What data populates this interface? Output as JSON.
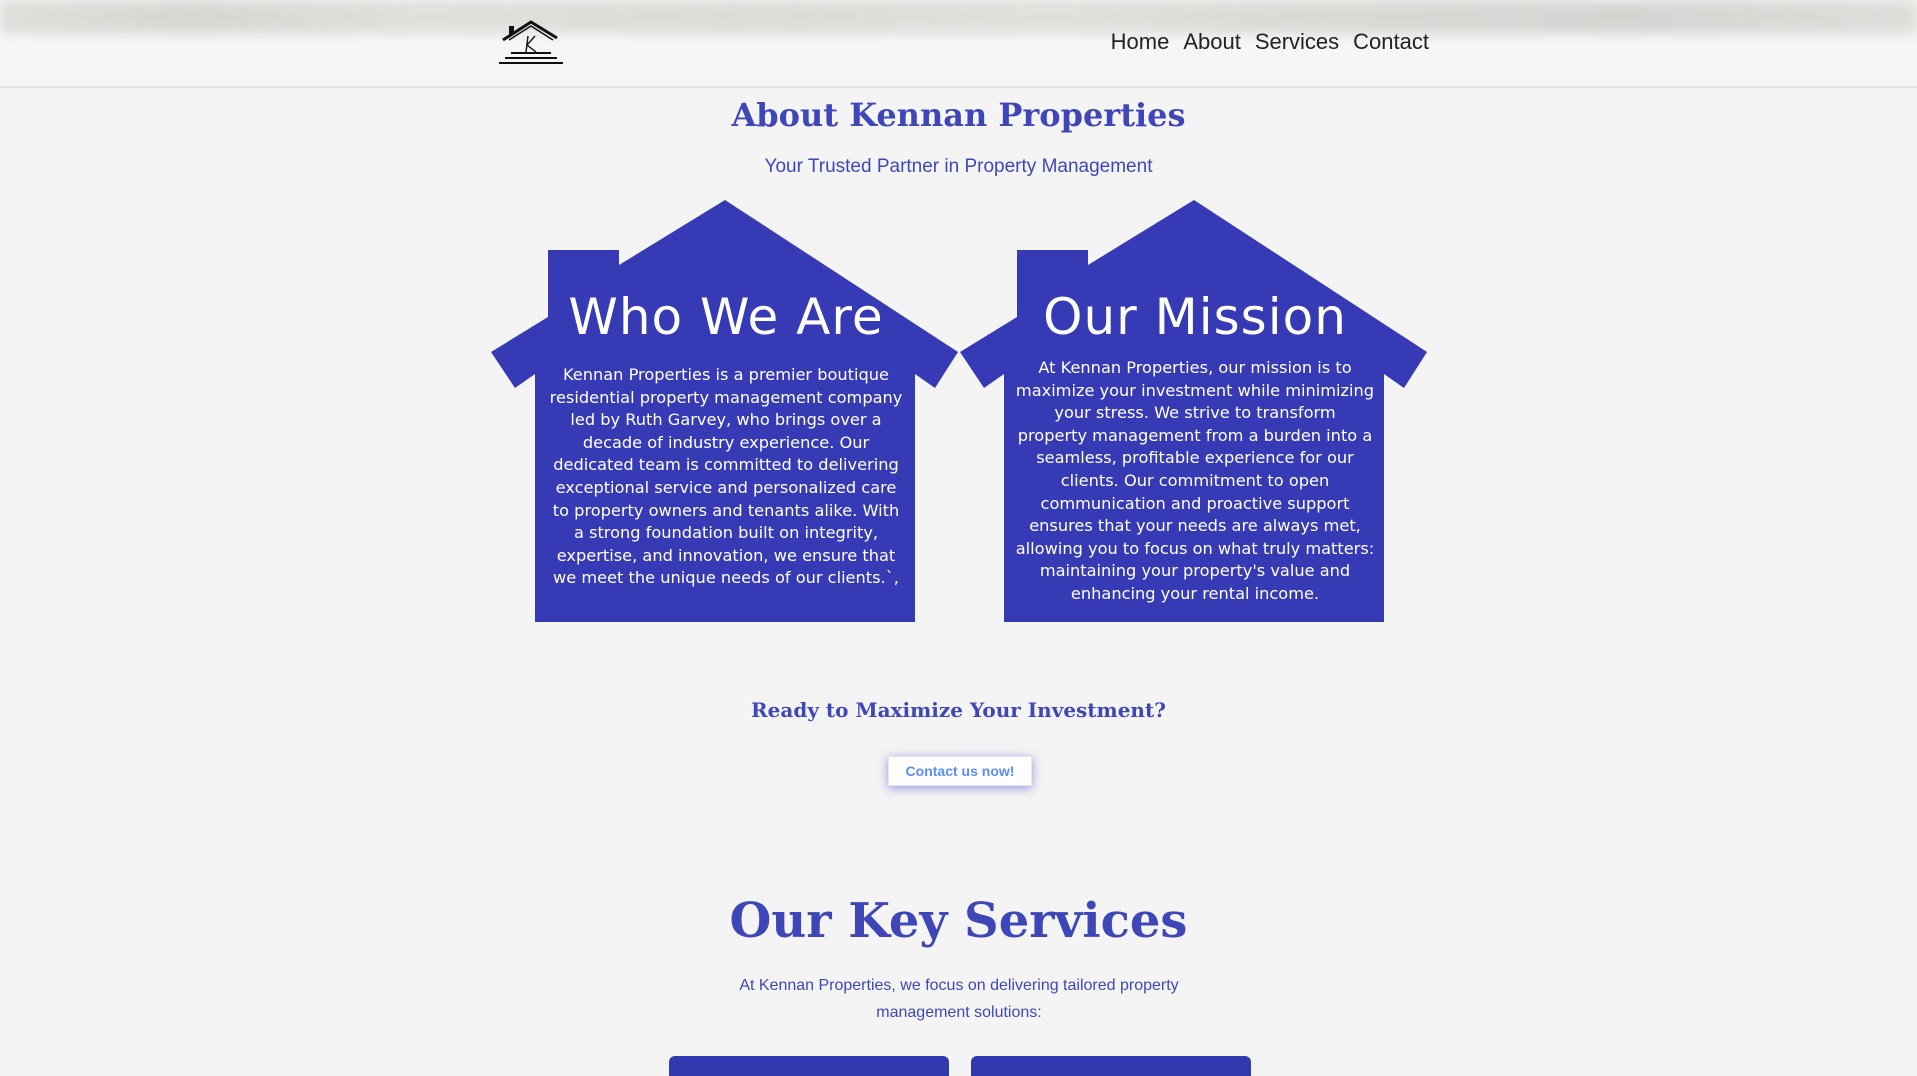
{
  "header": {
    "nav": [
      "Home",
      "About",
      "Services",
      "Contact"
    ]
  },
  "about": {
    "title": "About Kennan Properties",
    "subtitle": "Your Trusted Partner in Property Management"
  },
  "cards": [
    {
      "title": "Who We Are",
      "lines": [
        "Kennan Properties is a premier boutique",
        "residential property management company",
        "led by Ruth Garvey, who brings over a",
        "decade of industry experience. Our",
        "dedicated team is committed to delivering",
        "exceptional service and personalized care",
        "to property owners and tenants alike. With",
        "a strong foundation built on integrity,",
        "expertise, and innovation, we ensure that",
        "we meet the unique needs of our clients.`,"
      ]
    },
    {
      "title": "Our Mission",
      "lines": [
        "At Kennan Properties, our mission is to",
        "maximize your investment while minimizing",
        "your stress. We strive to transform",
        "property management from a burden into a",
        "seamless, profitable experience for our",
        "clients. Our commitment to open",
        "communication and proactive support",
        "ensures that your needs are always met,",
        "allowing you to focus on what truly matters:",
        "maintaining your property's value and",
        "enhancing your rental income."
      ]
    }
  ],
  "cta": {
    "title": "Ready to Maximize Your Investment?",
    "button": "Contact us now!"
  },
  "services": {
    "title": "Our Key Services",
    "description": "At Kennan Properties, we focus on delivering tailored property management solutions:"
  },
  "colors": {
    "brand": "#3f47b8",
    "house": "#363bb5",
    "link": "#5a8ef0"
  },
  "icons": {
    "logo": "house-k-logo"
  }
}
